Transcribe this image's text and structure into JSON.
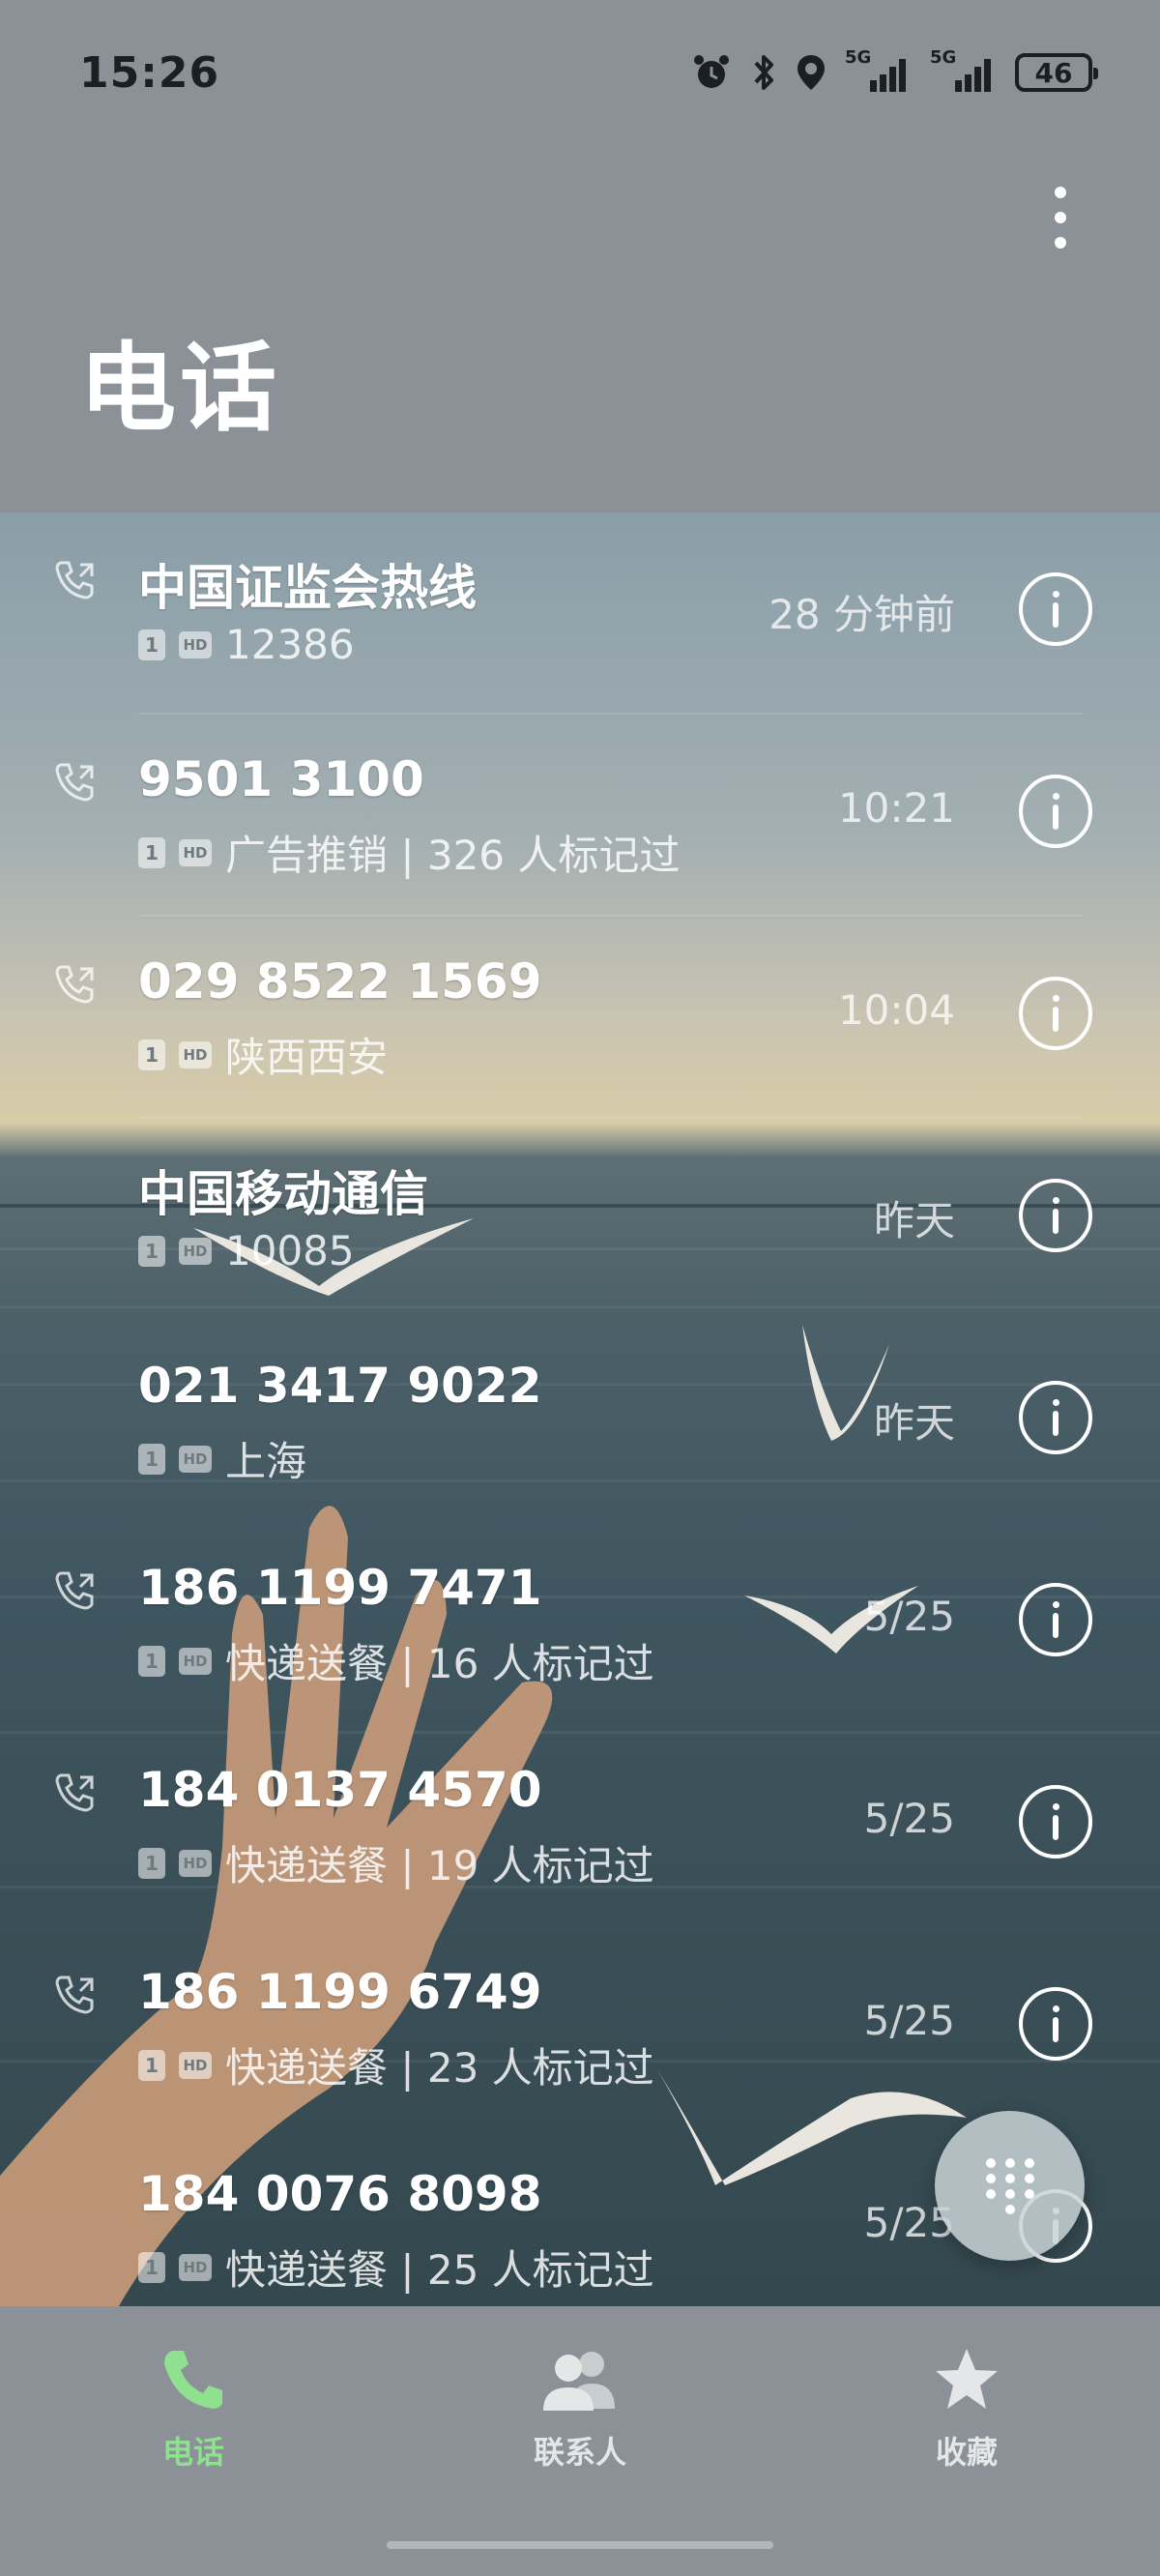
{
  "status_bar": {
    "time": "15:26",
    "signal_1_label": "5G",
    "signal_2_label": "5G",
    "battery": "46"
  },
  "header": {
    "title": "电话"
  },
  "calls": [
    {
      "name": "中国证监会热线",
      "sim": "1",
      "hd": "HD",
      "detail": "12386",
      "time": "28 分钟前",
      "icon": "outgoing-call-icon"
    },
    {
      "name": "9501 3100",
      "sim": "1",
      "hd": "HD",
      "detail": "广告推销 | 326 人标记过",
      "time": "10:21",
      "icon": "outgoing-call-icon"
    },
    {
      "name": "029 8522 1569",
      "sim": "1",
      "hd": "HD",
      "detail": "陕西西安",
      "time": "10:04",
      "icon": "outgoing-call-icon"
    },
    {
      "name": "中国移动通信",
      "sim": "1",
      "hd": "HD",
      "detail": "10085",
      "time": "昨天",
      "icon": ""
    },
    {
      "name": "021 3417 9022",
      "sim": "1",
      "hd": "HD",
      "detail": "上海",
      "time": "昨天",
      "icon": ""
    },
    {
      "name": "186 1199 7471",
      "sim": "1",
      "hd": "HD",
      "detail": "快递送餐 | 16 人标记过",
      "time": "5/25",
      "icon": "outgoing-call-icon"
    },
    {
      "name": "184 0137 4570",
      "sim": "1",
      "hd": "HD",
      "detail": "快递送餐 | 19 人标记过",
      "time": "5/25",
      "icon": "outgoing-call-icon"
    },
    {
      "name": "186 1199 6749",
      "sim": "1",
      "hd": "HD",
      "detail": "快递送餐 | 23 人标记过",
      "time": "5/25",
      "icon": "outgoing-call-icon"
    },
    {
      "name": "184 0076 8098",
      "sim": "1",
      "hd": "HD",
      "detail": "快递送餐 | 25 人标记过",
      "time": "5/25",
      "icon": ""
    }
  ],
  "nav": {
    "items": [
      {
        "label": "电话",
        "icon": "phone-icon",
        "active": true
      },
      {
        "label": "联系人",
        "icon": "contacts-icon",
        "active": false
      },
      {
        "label": "收藏",
        "icon": "star-icon",
        "active": false
      }
    ]
  },
  "colors": {
    "accent": "#8fe08f",
    "background": "#8b9197"
  }
}
